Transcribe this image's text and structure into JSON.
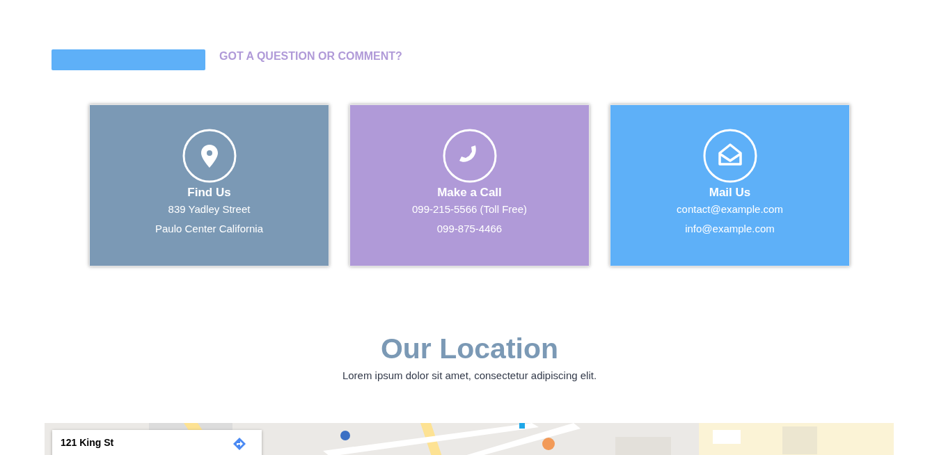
{
  "header": {
    "title": "GOT A QUESTION OR COMMENT?"
  },
  "contact_cards": [
    {
      "kind": "pin",
      "color": "#7b99b5",
      "title": "Find Us",
      "lines": [
        "839 Yadley Street",
        "Paulo Center California"
      ]
    },
    {
      "kind": "phone",
      "color": "#b09ad8",
      "title": "Make a Call",
      "lines": [
        "099-215-5566 (Toll Free)",
        "099-875-4466"
      ]
    },
    {
      "kind": "mail",
      "color": "#5eb0f8",
      "title": "Mail Us",
      "lines": [
        "contact@example.com",
        "info@example.com"
      ]
    }
  ],
  "location": {
    "title": "Our Location",
    "subtitle": "Lorem ipsum dolor sit amet, consectetur adipiscing elit."
  },
  "map": {
    "kind": "picture",
    "info_card": {
      "title": "121 King St"
    }
  }
}
